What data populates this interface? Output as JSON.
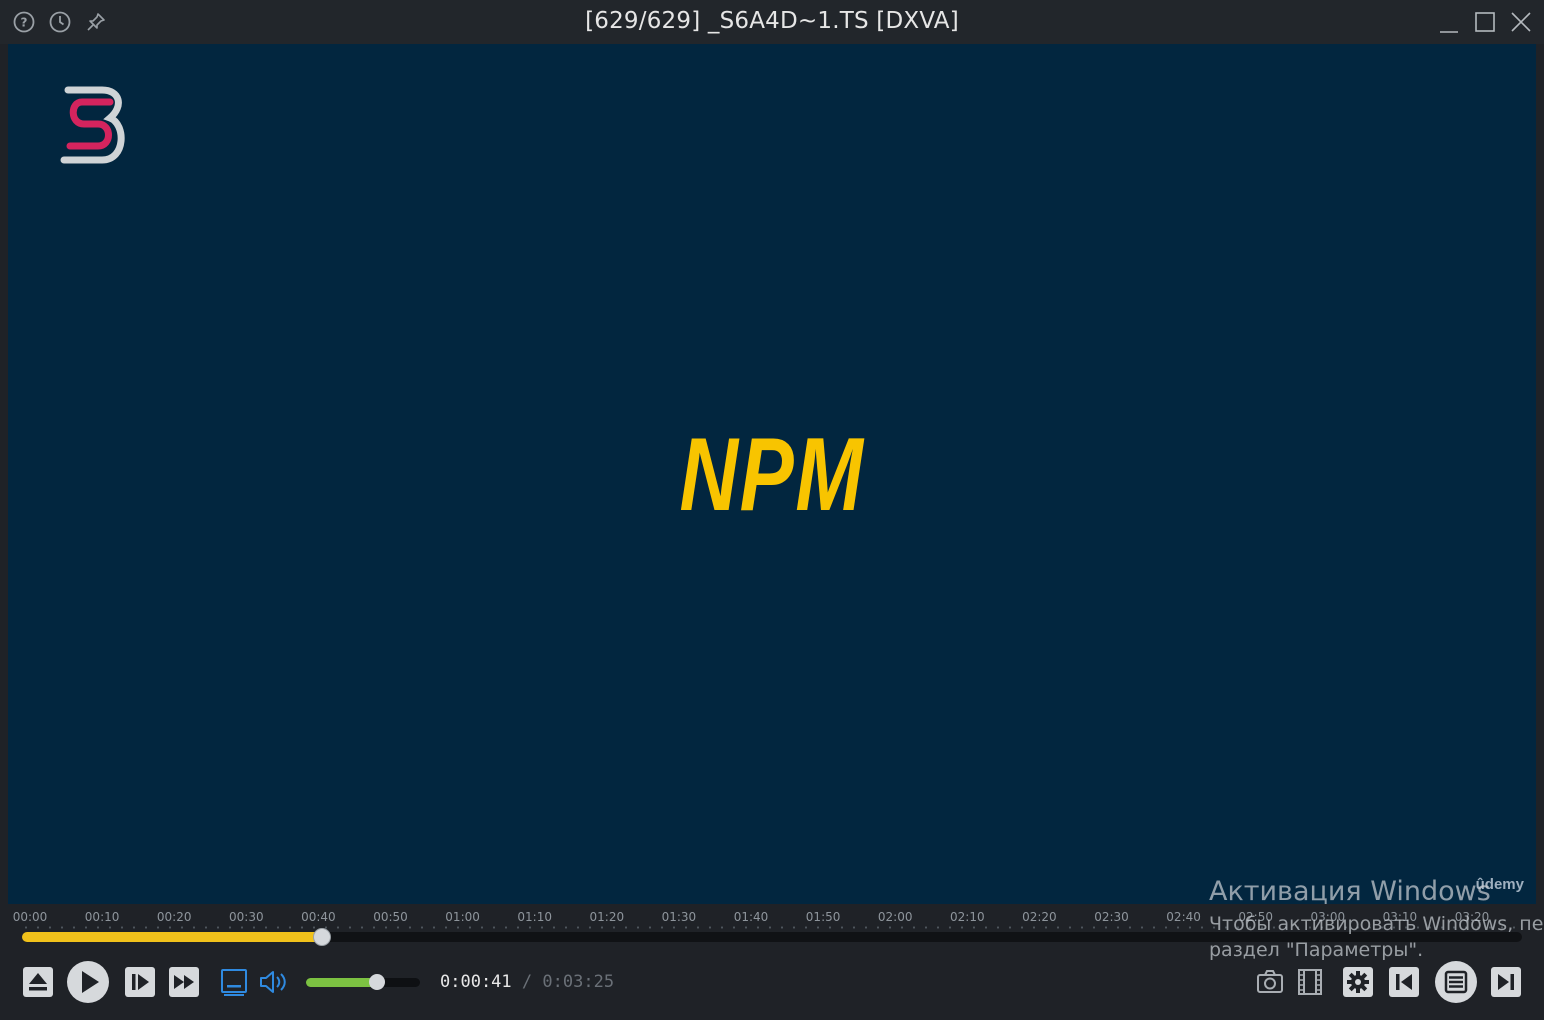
{
  "window": {
    "title": "[629/629] _S6A4D~1.TS [DXVA]"
  },
  "titlebar_icons": {
    "left": [
      "help-icon",
      "history-icon",
      "pin-icon"
    ],
    "right": [
      "minimize-icon",
      "maximize-icon",
      "close-icon"
    ]
  },
  "video": {
    "overlay_text": "NPM",
    "watermark_brand": "ûdemy",
    "background_color": "#02263f",
    "accent_color": "#f8c400"
  },
  "timeline": {
    "tick_labels": [
      "00:00",
      "00:10",
      "00:20",
      "00:30",
      "00:40",
      "00:50",
      "01:00",
      "01:10",
      "01:20",
      "01:30",
      "01:40",
      "01:50",
      "02:00",
      "02:10",
      "02:20",
      "02:30",
      "02:40",
      "02:50",
      "03:00",
      "03:10",
      "03:20"
    ],
    "progress_fraction": 0.2,
    "progress_color": "#f1c21b"
  },
  "playback": {
    "current_time": "0:00:41",
    "separator": "/",
    "total_time": "0:03:25",
    "volume_fraction": 0.62,
    "volume_color": "#7cc242"
  },
  "controls": {
    "left": [
      "eject-icon",
      "play-icon",
      "frame-step-icon",
      "fast-forward-icon",
      "subtitle-icon",
      "speaker-icon"
    ],
    "right": [
      "camera-icon",
      "film-icon",
      "gear-icon",
      "previous-icon",
      "playlist-icon",
      "next-icon"
    ]
  },
  "activation": {
    "title": "Активация Windows",
    "line1": "Чтобы активировать Windows, пе",
    "line2": "раздел \"Параметры\"."
  }
}
